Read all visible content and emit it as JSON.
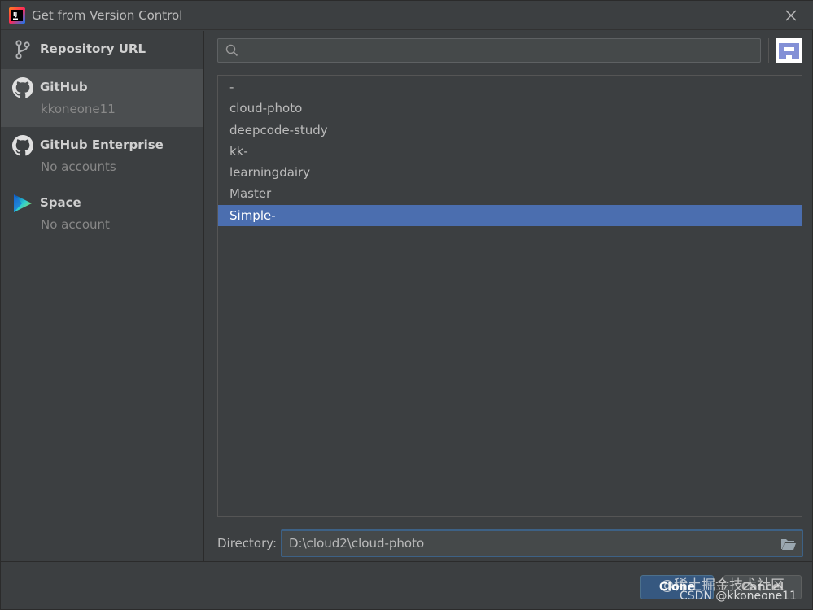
{
  "window": {
    "title": "Get from Version Control"
  },
  "sidebar": {
    "items": [
      {
        "label": "Repository URL",
        "sub": ""
      },
      {
        "label": "GitHub",
        "sub": "kkoneone11"
      },
      {
        "label": "GitHub Enterprise",
        "sub": "No accounts"
      },
      {
        "label": "Space",
        "sub": "No account"
      }
    ],
    "selected_index": 1
  },
  "search": {
    "value": "",
    "placeholder": ""
  },
  "repositories": {
    "items": [
      "-",
      "cloud-photo",
      "deepcode-study",
      "kk-",
      "learningdairy",
      "Master",
      "Simple-"
    ],
    "selected": "Simple-"
  },
  "directory": {
    "label": "Directory:",
    "value": "D:\\cloud2\\cloud-photo"
  },
  "buttons": {
    "clone": "Clone",
    "cancel": "Cancel"
  },
  "watermark": {
    "line1": "@稀土掘金技术社区",
    "line2": "CSDN @kkoneone11"
  },
  "colors": {
    "background": "#3c3f41",
    "selection": "#4b6eaf",
    "sidebar_selected": "#4b4e50",
    "primary_button": "#365880",
    "focus_border": "#3d6185"
  }
}
